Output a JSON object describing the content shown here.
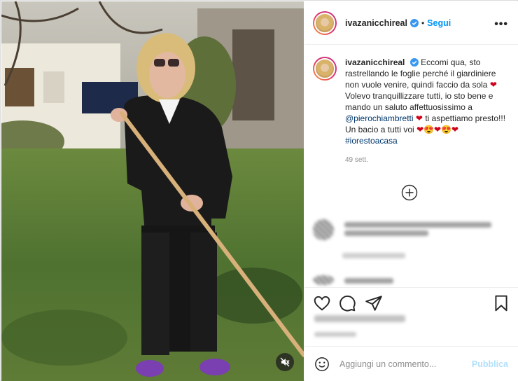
{
  "post": {
    "username": "ivazanicchireal",
    "verified": true,
    "follow_label": "Segui",
    "more_icon": "more-options-icon",
    "caption": {
      "username": "ivazanicchireal",
      "part1": "Eccomi qua, sto rastrellando le foglie perché il giardiniere non vuole venire, quindi faccio da sola",
      "heart1": "❤",
      "part2": "Volevo tranquillizzare tutti, io sto bene e mando un saluto affettuosissimo a",
      "mention": "@pierochiambretti",
      "heart2": "❤",
      "part3": "ti aspettiamo presto!!! Un bacio a tutti voi",
      "emojis": "❤😍❤😍❤",
      "hashtag": "#iorestoacasa"
    },
    "age": "49 sett."
  },
  "comment_input": {
    "placeholder": "Aggiungi un commento...",
    "publish_label": "Pubblica"
  },
  "colors": {
    "link": "#00376b",
    "follow": "#0095f6",
    "publish_disabled": "#b2dffc",
    "heart": "#d0021b"
  },
  "icons": [
    "verified-badge-icon",
    "more-options-icon",
    "load-more-plus-icon",
    "heart-icon",
    "comment-icon",
    "share-icon",
    "bookmark-icon",
    "emoji-icon",
    "mute-icon"
  ]
}
